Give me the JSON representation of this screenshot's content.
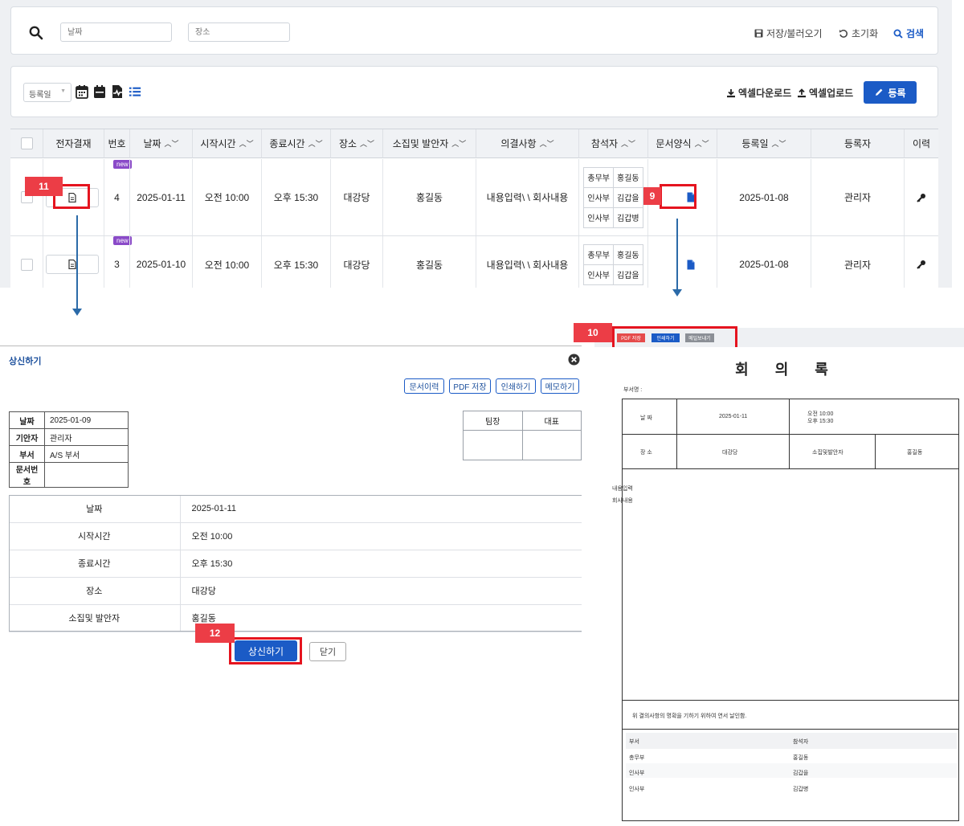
{
  "search": {
    "date_placeholder": "날짜",
    "place_placeholder": "장소",
    "save_load": "저장/불러오기",
    "reset": "초기화",
    "search": "검색"
  },
  "toolbar": {
    "date_select": "등록일",
    "excel_download": "엑셀다운로드",
    "excel_upload": "엑셀업로드",
    "register": "등록"
  },
  "table": {
    "headers": [
      "전자결재",
      "번호",
      "날짜",
      "시작시간",
      "종료시간",
      "장소",
      "소집및 발안자",
      "의결사항",
      "참석자",
      "문서양식",
      "등록일",
      "등록자",
      "이력"
    ],
    "new_badge": "new",
    "rows": [
      {
        "no": "4",
        "date": "2025-01-11",
        "start": "오전 10:00",
        "end": "오후 15:30",
        "place": "대강당",
        "convener": "홍길동",
        "resolution": "내용입력\\ \\ 회사내용",
        "attendees": [
          [
            "총무부",
            "홍길동"
          ],
          [
            "인사부",
            "김갑을"
          ],
          [
            "인사부",
            "김갑병"
          ]
        ],
        "reg_date": "2025-01-08",
        "registrant": "관리자"
      },
      {
        "no": "3",
        "date": "2025-01-10",
        "start": "오전 10:00",
        "end": "오후 15:30",
        "place": "대강당",
        "convener": "홍길동",
        "resolution": "내용입력\\ \\ 회사내용",
        "attendees": [
          [
            "총무부",
            "홍길동"
          ],
          [
            "인사부",
            "김갑을"
          ]
        ],
        "reg_date": "2025-01-08",
        "registrant": "관리자"
      }
    ]
  },
  "markers": {
    "m9": "9",
    "m10": "10",
    "m11": "11",
    "m12": "12"
  },
  "modal": {
    "title": "상신하기",
    "buttons": [
      "문서이력",
      "PDF 저장",
      "인쇄하기",
      "메모하기"
    ],
    "info": [
      [
        "날짜",
        "2025-01-09"
      ],
      [
        "기안자",
        "관리자"
      ],
      [
        "부서",
        "A/S 부서"
      ],
      [
        "문서번호",
        ""
      ]
    ],
    "approvers": [
      "팀장",
      "대표"
    ],
    "details": [
      [
        "날짜",
        "2025-01-11"
      ],
      [
        "시작시간",
        "오전 10:00"
      ],
      [
        "종료시간",
        "오후 15:30"
      ],
      [
        "장소",
        "대강당"
      ],
      [
        "소집및 발안자",
        "홍길동"
      ]
    ],
    "submit": "상신하기",
    "close": "닫기"
  },
  "doc": {
    "actions": [
      "PDF 저장",
      "인쇄하기",
      "메일보내기"
    ],
    "title": "회 의 록",
    "dept_label": "부서명 :",
    "date_label": "날 짜",
    "date_value": "2025-01-11",
    "time_start": "오전 10:00",
    "time_end": "오후 15:30",
    "place_label": "장 소",
    "place_value": "대강당",
    "convener_label": "소집및발안자",
    "convener_value": "홍길동",
    "content_line1": "내용입력",
    "content_line2": "회사내용",
    "statement": "위 결의사항의 명확을 기하기 위하여 연서  날인함.",
    "att_header": [
      "부서",
      "참석자"
    ],
    "att_rows": [
      [
        "총무부",
        "홍길동"
      ],
      [
        "인사부",
        "김갑을"
      ],
      [
        "인사부",
        "김갑병"
      ]
    ]
  },
  "colors": {
    "primary": "#1b5bc6",
    "highlight": "#e5141f",
    "marker": "#ec3d46",
    "new_badge": "#8a4ac8"
  }
}
